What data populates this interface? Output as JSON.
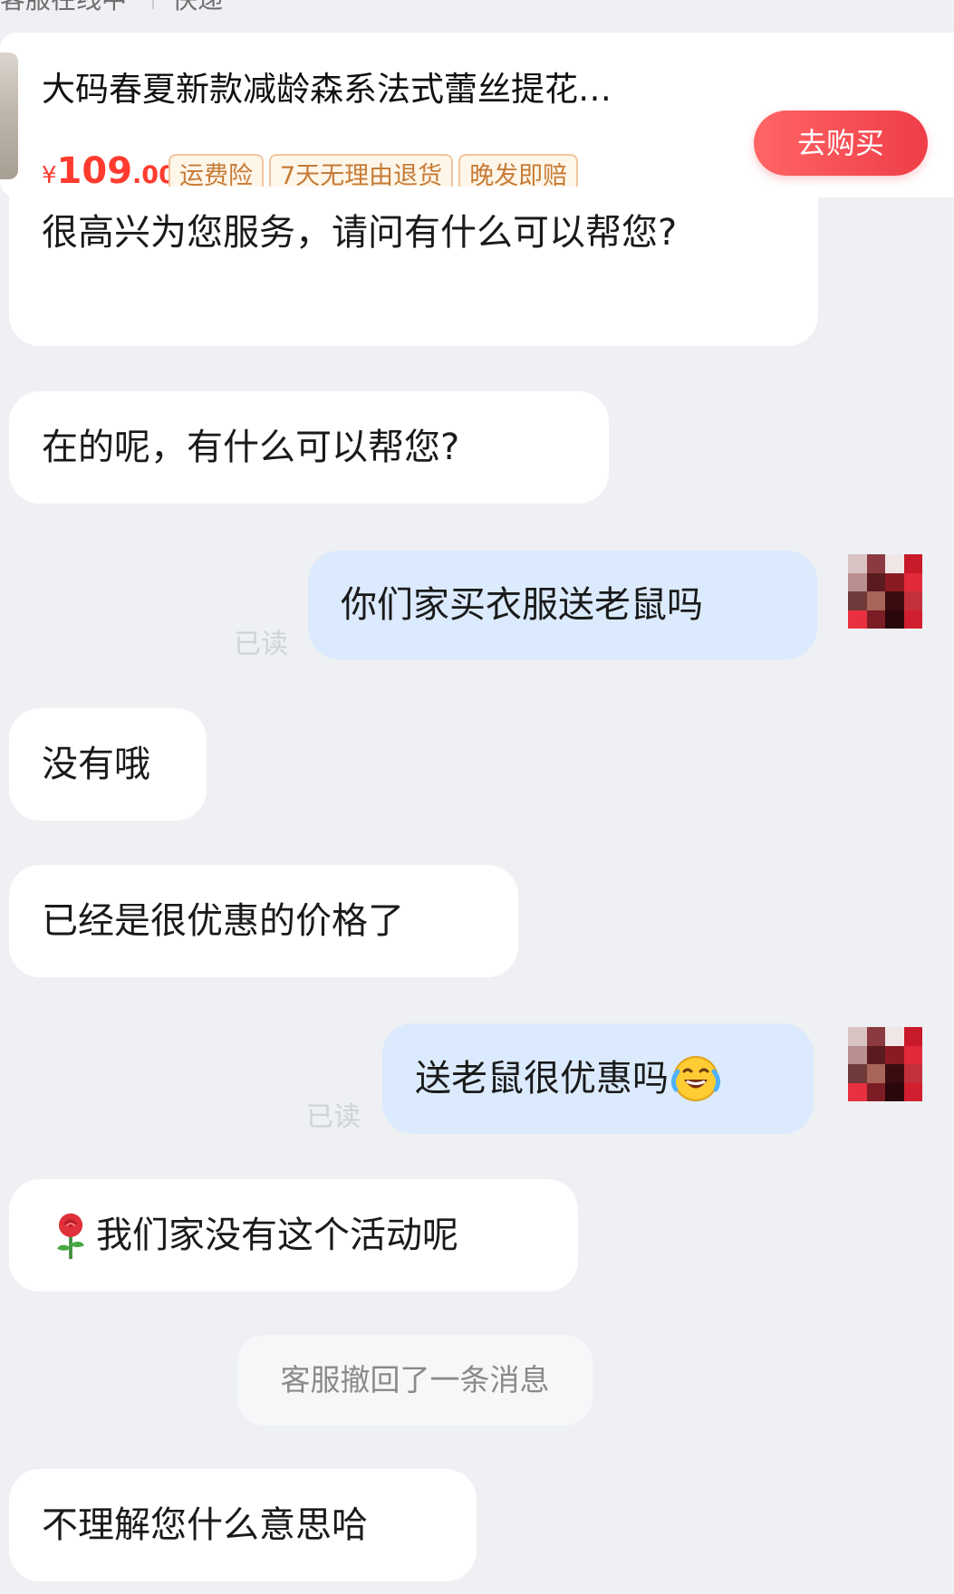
{
  "top_status": {
    "left_text": "客服在线中",
    "right_text": "快递"
  },
  "product": {
    "title": "大码春夏新款减龄森系法式蕾丝提花…",
    "price_symbol": "¥",
    "price_integer": "109",
    "price_decimal": ".00",
    "tags": [
      "运费险",
      "7天无理由退货",
      "晚发即赔"
    ],
    "buy_label": "去购买"
  },
  "messages": [
    {
      "side": "left",
      "text": "很高兴为您服务，请问有什么可以帮您?"
    },
    {
      "side": "left",
      "text": "在的呢，有什么可以帮您?"
    },
    {
      "side": "right",
      "text": "你们家买衣服送老鼠吗",
      "status": "已读"
    },
    {
      "side": "left",
      "text": "没有哦"
    },
    {
      "side": "left",
      "text": "已经是很优惠的价格了"
    },
    {
      "side": "right",
      "text": "送老鼠很优惠吗",
      "emoji": "laughing-crying-emoji",
      "status": "已读"
    },
    {
      "side": "left",
      "text": "我们家没有这个活动呢",
      "emoji": "rose-emoji"
    },
    {
      "side": "left",
      "text": "不理解您什么意思哈"
    }
  ],
  "system_notice": "客服撤回了一条消息",
  "colors": {
    "background": "#eef0f3",
    "bubble_left": "#ffffff",
    "bubble_right": "#dbeafc",
    "price": "#ff3b2f",
    "buy_button": "#ef3d48",
    "tag_text": "#c67b35"
  }
}
